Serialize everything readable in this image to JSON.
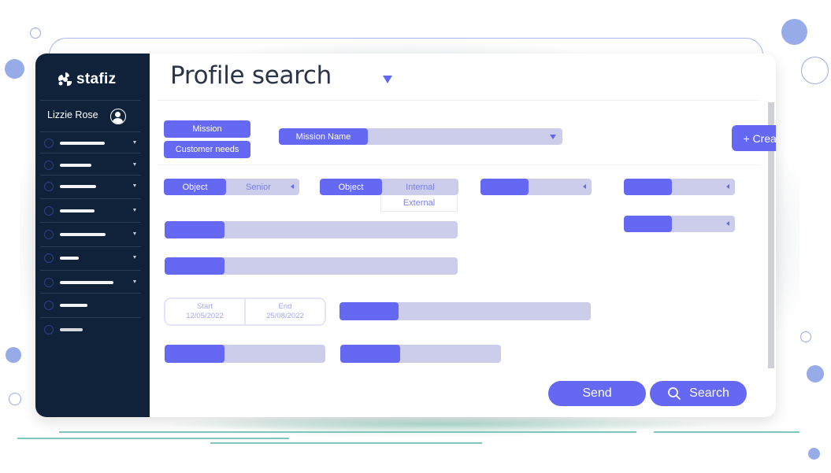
{
  "app": {
    "brand": "stafiz",
    "accent_color": "#6468f2",
    "field_bg_color": "#cccdeb",
    "sidebar_color": "#10223a"
  },
  "sidebar": {
    "user_name": "Lizzie Rose",
    "items": [
      {
        "label": "",
        "has_caret": true
      },
      {
        "label": "",
        "has_caret": true
      },
      {
        "label": "",
        "has_caret": true
      },
      {
        "label": "",
        "has_caret": true
      },
      {
        "label": "",
        "has_caret": true
      },
      {
        "label": "",
        "has_caret": true
      },
      {
        "label": "",
        "has_caret": true
      },
      {
        "label": "",
        "has_caret": false
      },
      {
        "label": "",
        "has_caret": false
      }
    ]
  },
  "header": {
    "title": "Profile search"
  },
  "filters": {
    "type_buttons": [
      "Mission",
      "Customer needs"
    ],
    "mission_name_label": "Mission Name",
    "mission_name_value": "",
    "create_button": "+ Create a mission",
    "object_1": {
      "label": "Object",
      "value": "Senior"
    },
    "object_2": {
      "label": "Object",
      "value": "Internal",
      "options": [
        "Internal",
        "External"
      ]
    },
    "date_range": {
      "start_label": "Start",
      "start_value": "12/05/2022",
      "end_label": "End",
      "end_value": "25/08/2022"
    }
  },
  "actions": {
    "send": "Send",
    "search": "Search"
  }
}
